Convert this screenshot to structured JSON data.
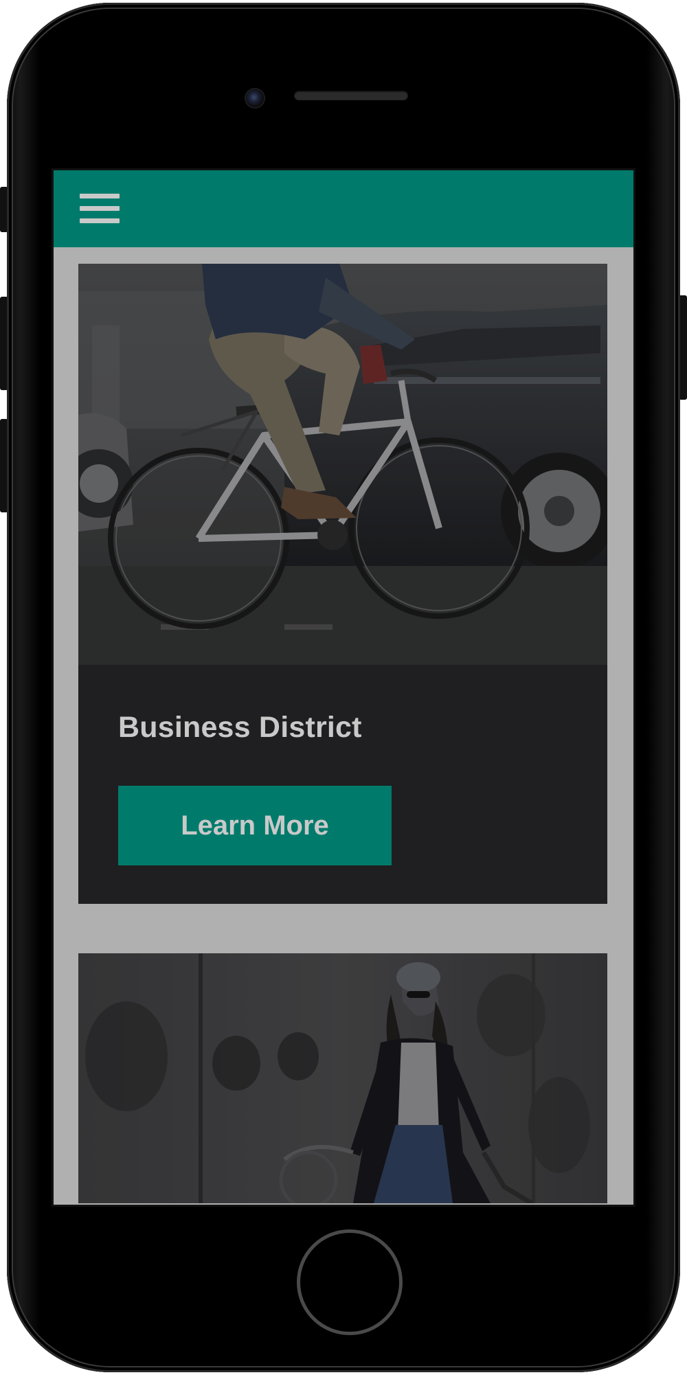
{
  "colors": {
    "accent": "#007b6b",
    "screen_background": "#b0b0b0",
    "card_background": "#1f1e20",
    "text": "#c9c9c9"
  },
  "header": {
    "menu_icon": "hamburger-menu-icon"
  },
  "cards": [
    {
      "image": "cyclist-riding-bicycle-past-cars-photo",
      "title": "Business District",
      "button_label": "Learn More"
    },
    {
      "image": "woman-with-bicycle-against-concrete-wall-photo"
    }
  ],
  "device": {
    "model_icon": "smartphone-frame",
    "home_button": "home-button-icon"
  }
}
